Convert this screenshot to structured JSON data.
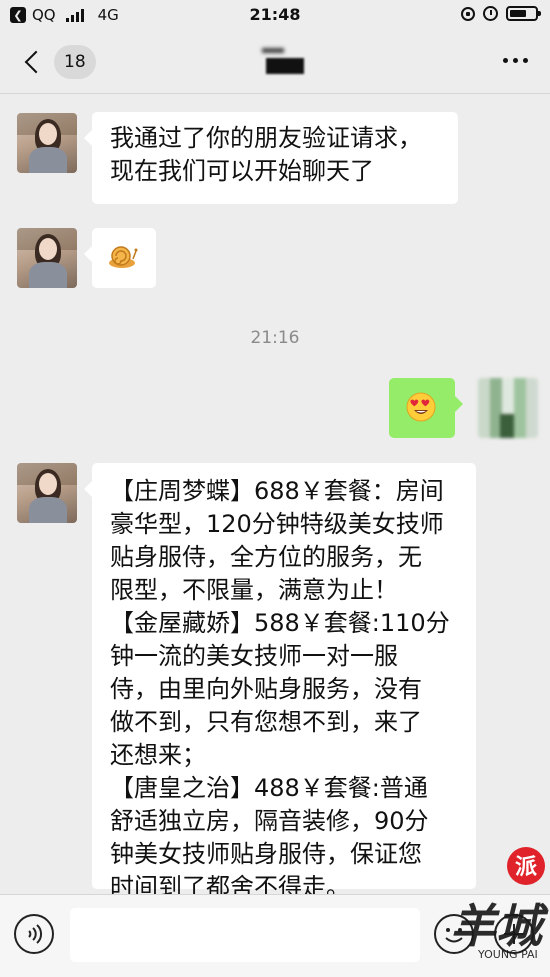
{
  "status_bar": {
    "app_badge": "QQ",
    "network": "4G",
    "time": "21:48"
  },
  "nav": {
    "unread_count": "18"
  },
  "messages": [
    {
      "sender": "contact",
      "lines": [
        "我通过了你的朋友验证请求，",
        "现在我们可以开始聊天了"
      ]
    },
    {
      "sender": "contact",
      "icon": "snail-emoji-icon"
    },
    {
      "sender": "me",
      "icon": "heart-eyes-emoji-icon"
    },
    {
      "sender": "contact",
      "lines": [
        "【庄周梦蝶】688￥套餐：房间",
        "豪华型，120分钟特级美女技师",
        "贴身服侍，全方位的服务，无",
        "限型，不限量，满意为止！",
        "【金屋藏娇】588￥套餐:110分",
        "钟一流的美女技师一对一服",
        "侍，由里向外贴身服务，没有",
        "做不到，只有您想不到，来了",
        "还想来；",
        "【唐皇之治】488￥套餐:普通",
        "舒适独立房，隔音装修，90分",
        "钟美女技师贴身服侍，保证您",
        "时间到了都舍不得走。"
      ]
    }
  ],
  "time_divider": "21:16",
  "watermark": {
    "brand": "羊城",
    "badge": "派",
    "tagline": "YOUNG PAI",
    "brand_color": "#1a1a1a",
    "badge_color": "#e0222a"
  },
  "colors": {
    "background": "#ededed",
    "outgoing_bubble": "#95ec69",
    "incoming_bubble": "#ffffff"
  }
}
